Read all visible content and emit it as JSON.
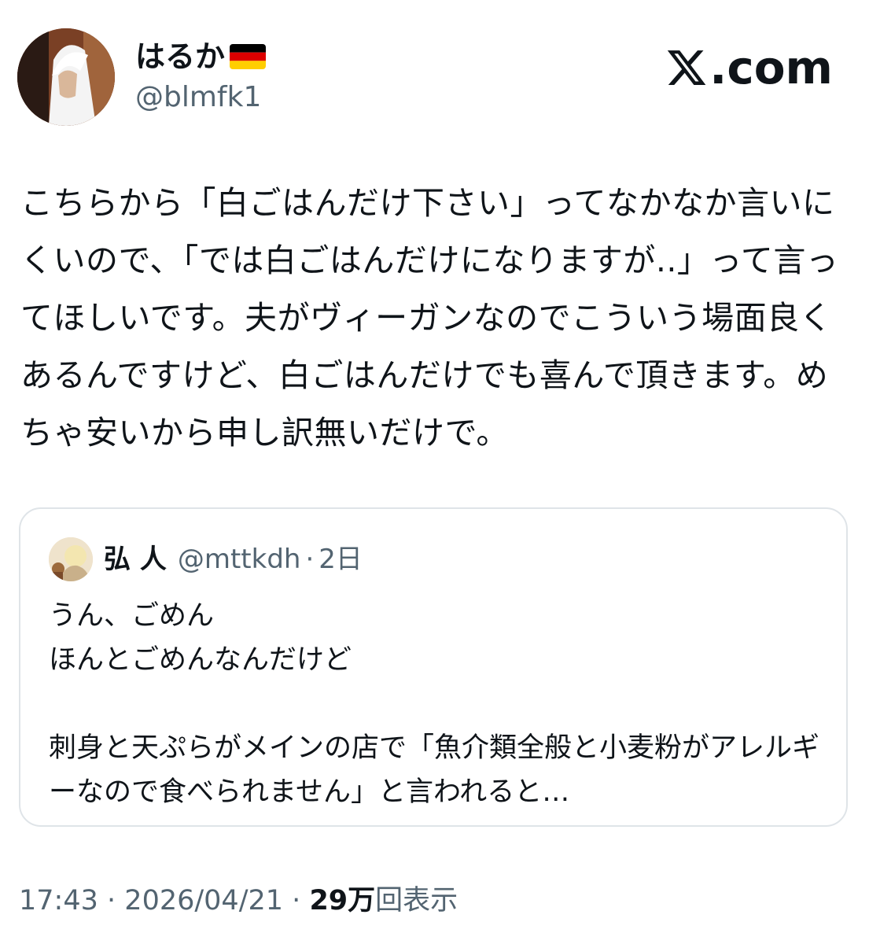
{
  "author": {
    "display_name": "はるか",
    "flag": "germany-flag-icon",
    "handle": "@blmfk1"
  },
  "brand": {
    "logo_text": ".com",
    "logo_icon": "x-logo-icon"
  },
  "tweet": {
    "text": "こちらから「白ごはんだけ下さい」ってなかなか言いにくいので、「では白ごはんだけになりますが..」って言ってほしいです。夫がヴィーガンなのでこういう場面良くあるんですけど、白ごはんだけでも喜んで頂きます。めちゃ安いから申し訳無いだけで。"
  },
  "quote": {
    "name": "弘 人",
    "handle": "@mttkdh",
    "separator": "·",
    "time": "2日",
    "text": "うん、ごめん\nほんとごめんなんだけど\n\n刺身と天ぷらがメインの店で「魚介類全般と小麦粉がアレルギーなので食べられません」と言われると…"
  },
  "meta": {
    "time": "17:43",
    "separator": "·",
    "date": "2026/04/21",
    "views_count": "29万",
    "views_label": "回表示"
  },
  "colors": {
    "text": "#0f1419",
    "secondary": "#536471",
    "border": "#dfe4e8"
  }
}
